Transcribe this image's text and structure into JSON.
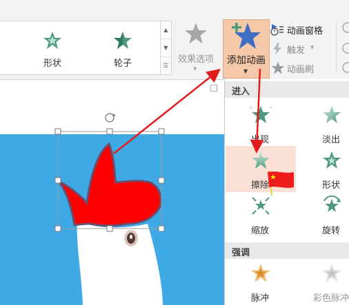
{
  "gallery": {
    "items": [
      {
        "label": "形状",
        "icon": "shape-star-icon"
      },
      {
        "label": "轮子",
        "icon": "wheel-star-icon"
      }
    ]
  },
  "effect_options": {
    "label": "效果选项"
  },
  "add_animation": {
    "label": "添加动画"
  },
  "right_commands": [
    {
      "label": "动画窗格",
      "icon": "animation-pane-icon"
    },
    {
      "label": "触发",
      "icon": "trigger-icon"
    },
    {
      "label": "动画刷",
      "icon": "animation-painter-icon"
    }
  ],
  "dropdown": {
    "entrance_header": "进入",
    "entrance_effects": [
      {
        "label": "出现"
      },
      {
        "label": "淡出"
      },
      {
        "label": "擦除"
      },
      {
        "label": "形状"
      },
      {
        "label": "缩放"
      },
      {
        "label": "旋转"
      }
    ],
    "emphasis_header": "强调",
    "emphasis_effects": [
      {
        "label": "脉冲"
      },
      {
        "label": "彩色脉冲"
      }
    ]
  },
  "colors": {
    "accent_highlight": "#f5c8aa",
    "slide_bg": "#3fa9e6",
    "arrow": "#e11b1b",
    "star_green": "#4f9a7f",
    "star_blue": "#3c6fc4"
  }
}
